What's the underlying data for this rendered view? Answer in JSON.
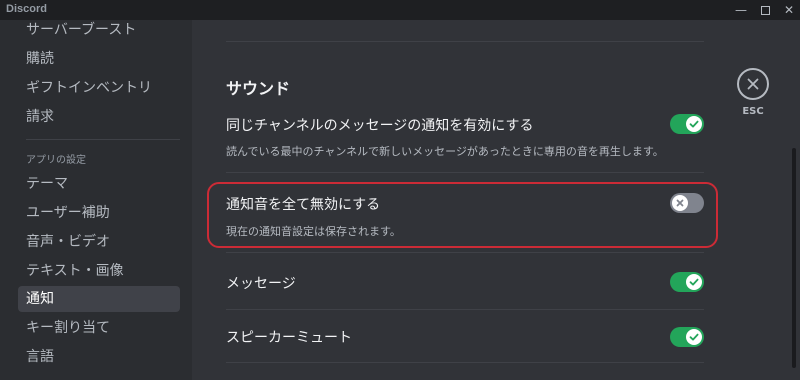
{
  "window": {
    "title": "Discord",
    "controls": {
      "minimize": "—",
      "maximize": "",
      "close": "✕"
    }
  },
  "sidebar": {
    "items_top": [
      {
        "label": "サーバーブースト"
      },
      {
        "label": "購読"
      },
      {
        "label": "ギフトインベントリ"
      },
      {
        "label": "請求"
      }
    ],
    "app_settings_header": "アプリの設定",
    "items_app": [
      {
        "label": "テーマ"
      },
      {
        "label": "ユーザー補助"
      },
      {
        "label": "音声・ビデオ"
      },
      {
        "label": "テキスト・画像"
      },
      {
        "label": "通知",
        "selected": true
      },
      {
        "label": "キー割り当て"
      },
      {
        "label": "言語"
      }
    ]
  },
  "content": {
    "section_title": "サウンド",
    "settings": [
      {
        "title": "同じチャンネルのメッセージの通知を有効にする",
        "description": "読んでいる最中のチャンネルで新しいメッセージがあったときに専用の音を再生します。",
        "enabled": true
      },
      {
        "title": "通知音を全て無効にする",
        "description": "現在の通知音設定は保存されます。",
        "enabled": false,
        "highlighted": true
      },
      {
        "title": "メッセージ",
        "enabled": true
      },
      {
        "title": "スピーカーミュート",
        "enabled": true
      }
    ],
    "close_label": "ESC"
  },
  "colors": {
    "toggle_on": "#23a55a",
    "toggle_off": "#80848e",
    "highlight": "#cc2b36",
    "background": "#313338",
    "sidebar": "#2b2d31"
  },
  "icons": {
    "close": "close-circle-icon",
    "toggle_on": "check-icon",
    "toggle_off": "x-icon"
  }
}
